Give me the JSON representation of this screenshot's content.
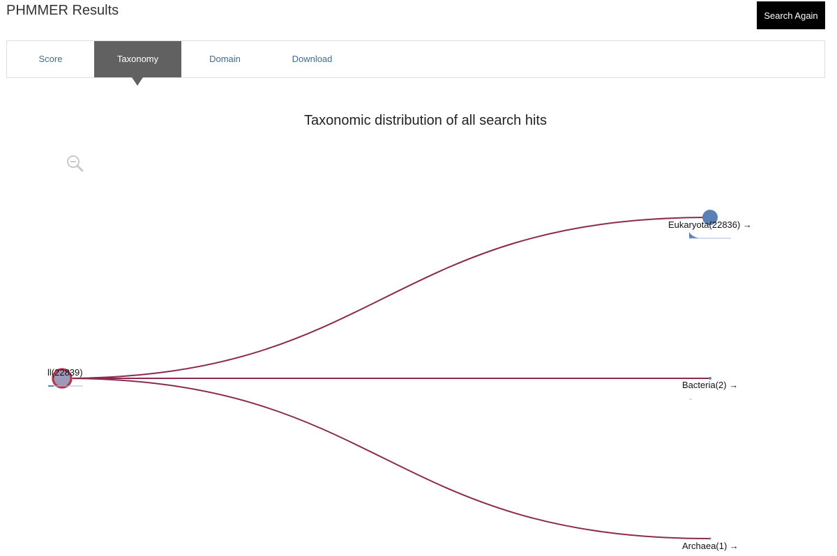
{
  "header": {
    "title": "PHMMER Results",
    "search_again_label": "Search Again"
  },
  "tabs": [
    {
      "label": "Score",
      "active": false
    },
    {
      "label": "Taxonomy",
      "active": true
    },
    {
      "label": "Domain",
      "active": false
    },
    {
      "label": "Download",
      "active": false
    }
  ],
  "tree": {
    "title": "Taxonomic distribution of all search hits",
    "root": {
      "label": "ll(22839)",
      "count": 22839
    },
    "children": [
      {
        "label": "Eukaryota(22836) →",
        "count": 22836
      },
      {
        "label": "Bacteria(2) →",
        "count": 2
      },
      {
        "label": "Archaea(1) →",
        "count": 1
      }
    ],
    "colors": {
      "link": "#8b2a4e",
      "node_fill": "#5b80b6",
      "root_ring": "#b3364d",
      "root_halo": "#f1b7bc"
    }
  }
}
